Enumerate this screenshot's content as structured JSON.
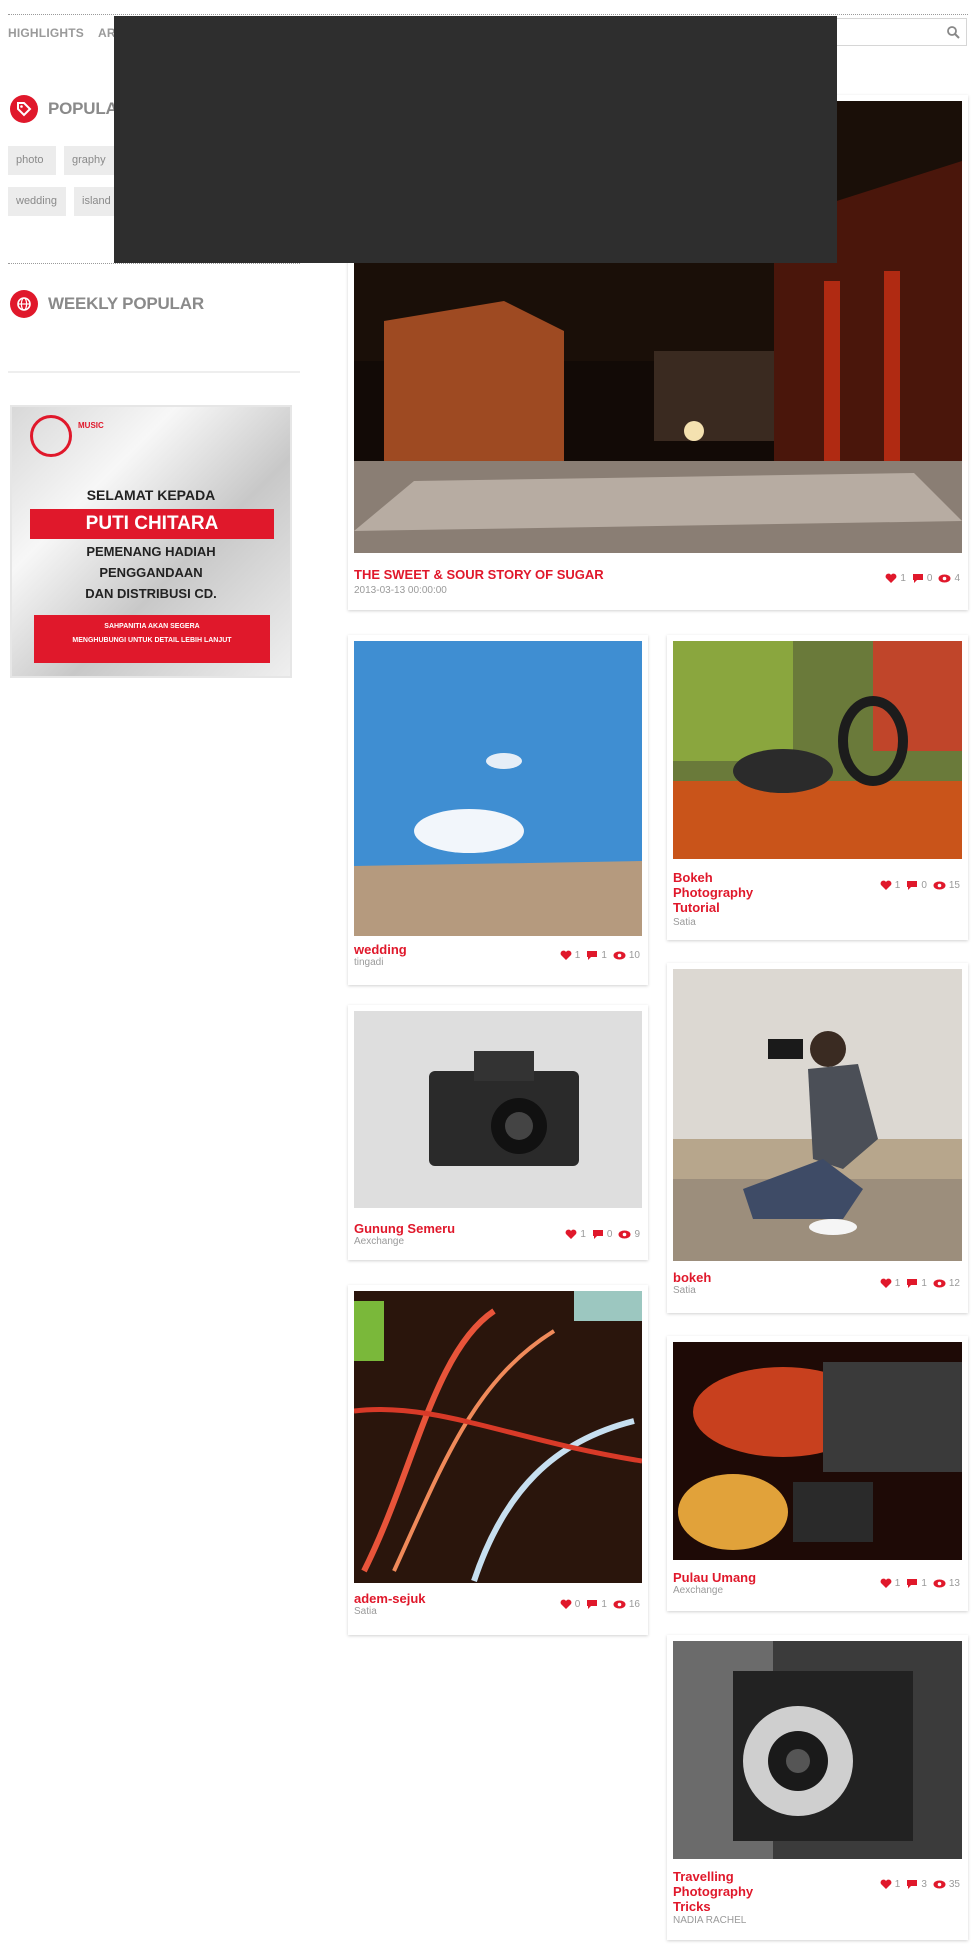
{
  "nav": {
    "items": [
      "HIGHLIGHTS",
      "ARTIC"
    ]
  },
  "search": {
    "placeholder": ""
  },
  "popular": {
    "title": "POPULAR",
    "tags": [
      "photo",
      "graphy",
      "wedding",
      "island"
    ]
  },
  "weekly": {
    "title": "WEEKLY POPULAR"
  },
  "ad": {
    "logo_text": "MUSIC",
    "line1": "SELAMAT KEPADA",
    "highlight": "PUTI CHITARA",
    "line2": "PEMENANG HADIAH",
    "line3": "PENGGANDAAN",
    "line4": "DAN DISTRIBUSI CD.",
    "cta1": "SAHPANITIA AKAN SEGERA",
    "cta2": "MENGHUBUNGI UNTUK DETAIL LEBIH LANJUT"
  },
  "posts": [
    {
      "title": "THE SWEET & SOUR STORY OF SUGAR",
      "sub": "2013-03-13 00:00:00",
      "likes": "1",
      "comments": "0",
      "views": "4"
    },
    {
      "title": "wedding",
      "sub": "tingadi",
      "likes": "1",
      "comments": "1",
      "views": "10"
    },
    {
      "title": "Bokeh Photography Tutorial",
      "sub": "Satia",
      "likes": "1",
      "comments": "0",
      "views": "15"
    },
    {
      "title": "Gunung Semeru",
      "sub": "Aexchange",
      "likes": "1",
      "comments": "0",
      "views": "9"
    },
    {
      "title": "bokeh",
      "sub": "Satia",
      "likes": "1",
      "comments": "1",
      "views": "12"
    },
    {
      "title": "adem-sejuk",
      "sub": "Satia",
      "likes": "0",
      "comments": "1",
      "views": "16"
    },
    {
      "title": "Pulau Umang",
      "sub": "Aexchange",
      "likes": "1",
      "comments": "1",
      "views": "13"
    },
    {
      "title": "Travelling Photography Tricks",
      "sub": "NADIA RACHEL",
      "likes": "1",
      "comments": "3",
      "views": "35"
    }
  ],
  "colors": {
    "accent": "#e0182b",
    "muted": "#9a9a9a",
    "overlay": "#2e2e2e"
  }
}
